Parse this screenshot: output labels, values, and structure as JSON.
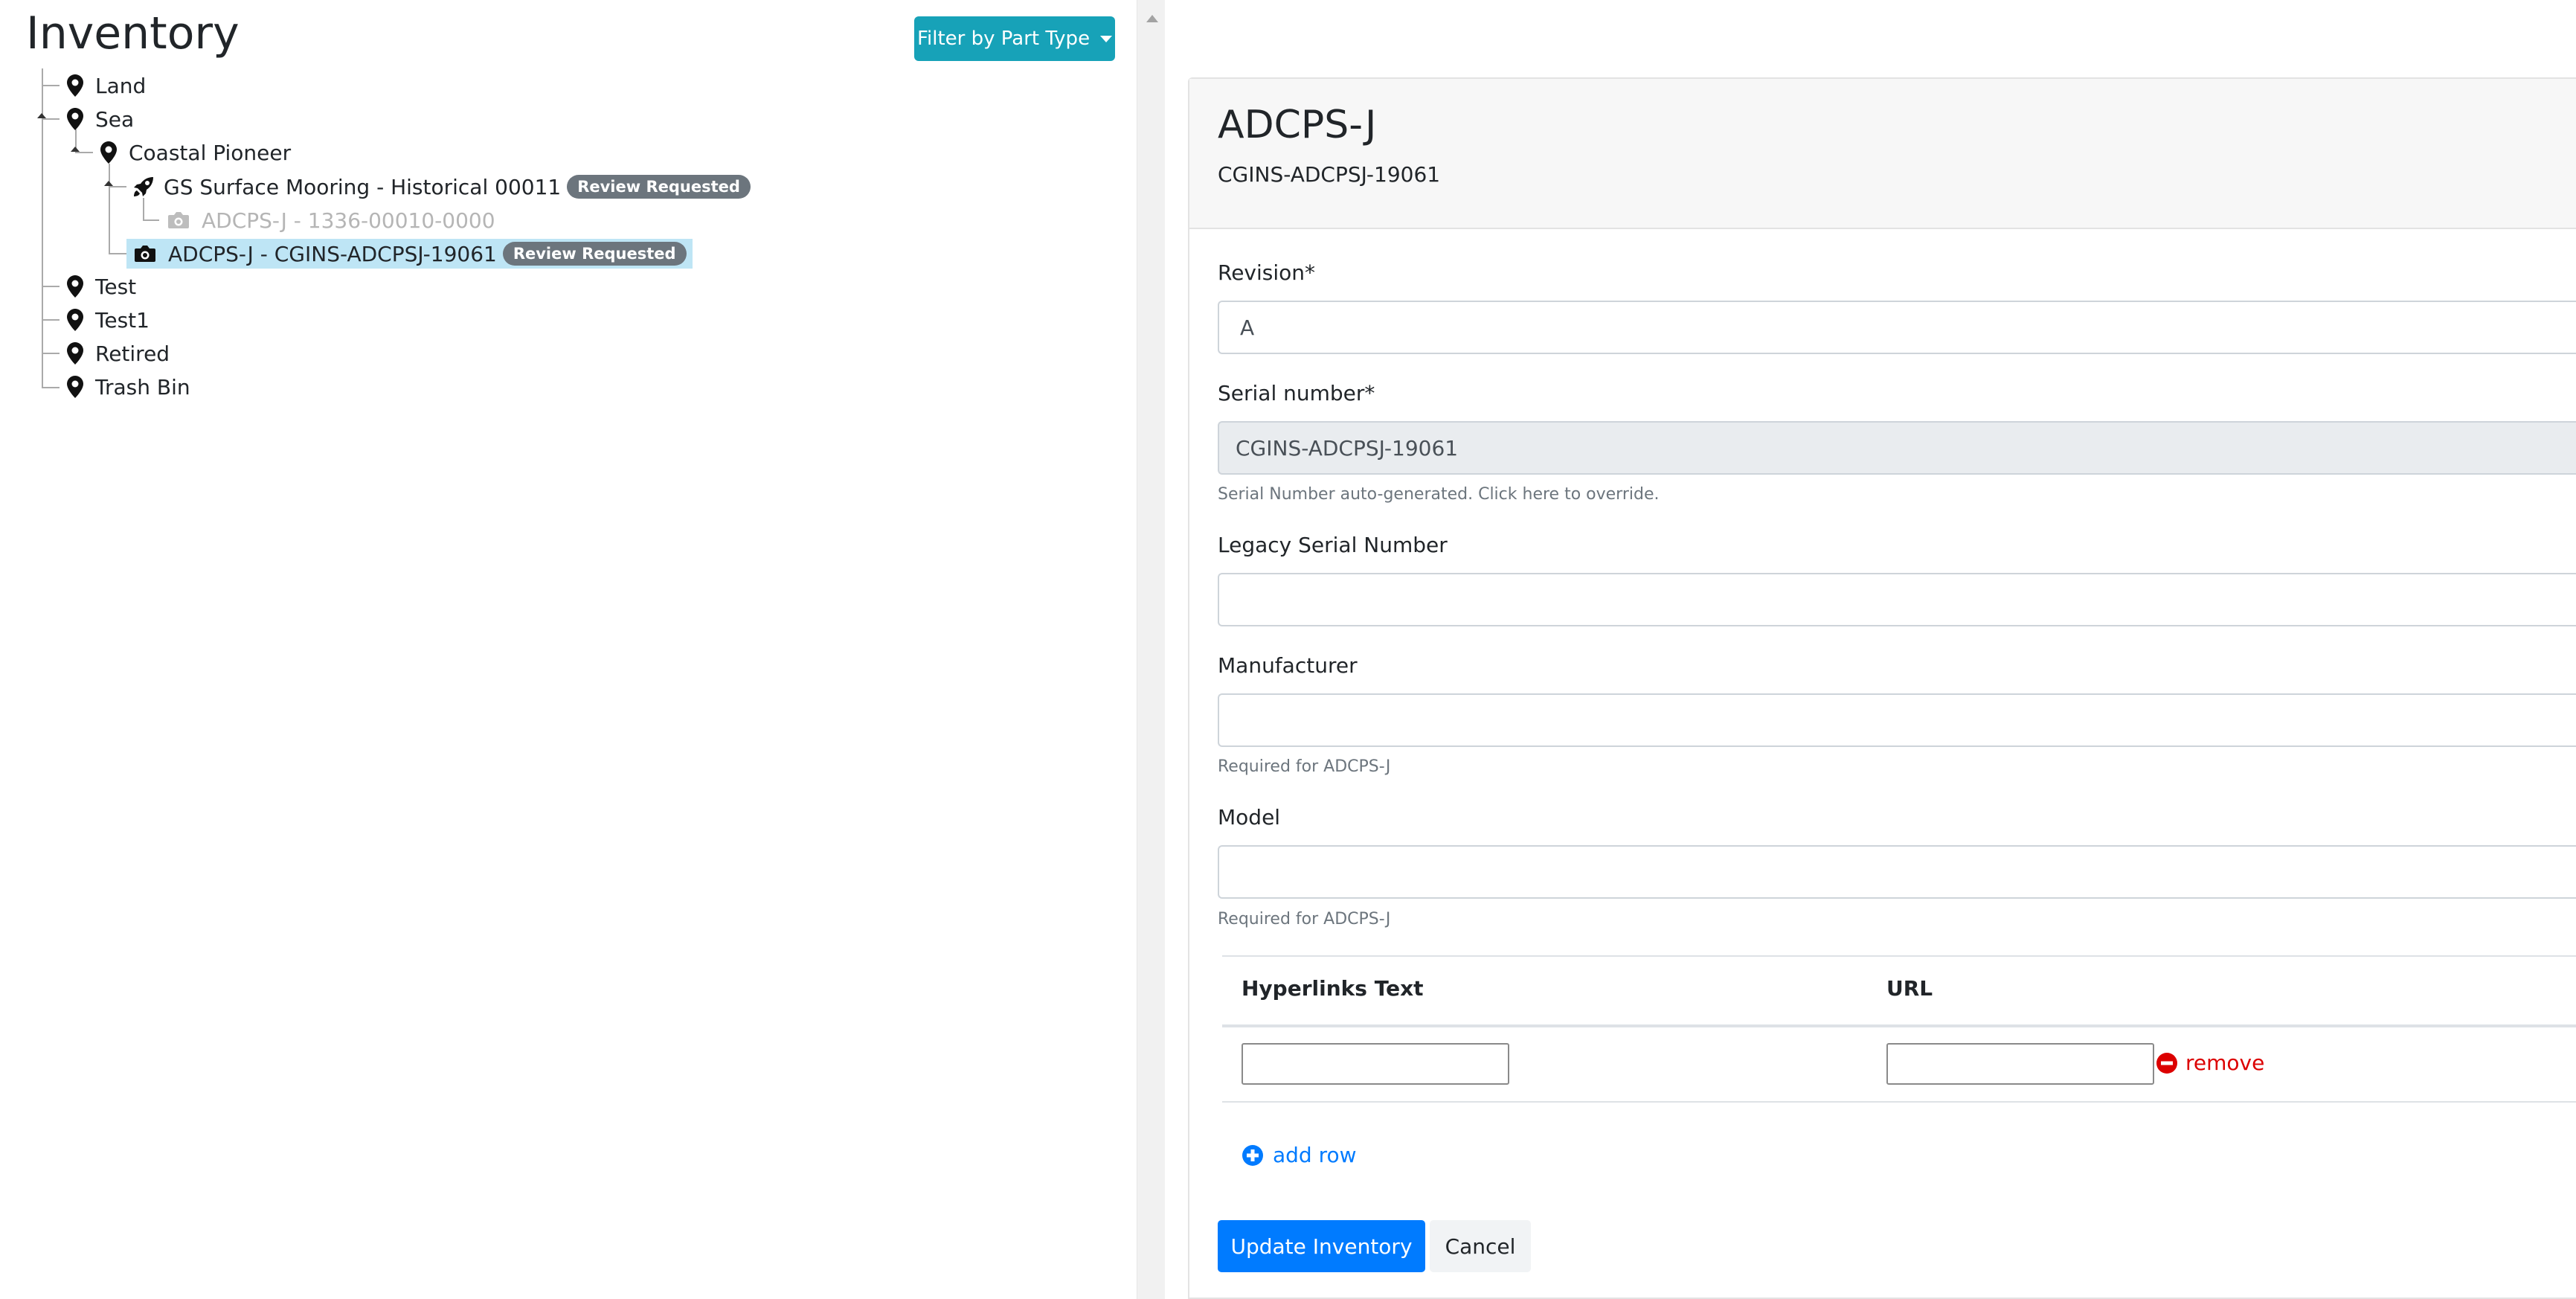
{
  "page": {
    "title": "Inventory",
    "filter_button": "Filter by Part Type"
  },
  "tree": {
    "land": "Land",
    "sea": "Sea",
    "coastal_pioneer": "Coastal Pioneer",
    "mooring": "GS Surface Mooring - Historical 00011",
    "mooring_badge": "Review Requested",
    "child_part": "ADCPS-J - 1336-00010-0000",
    "selected_part": "ADCPS-J - CGINS-ADCPSJ-19061",
    "selected_badge": "Review Requested",
    "test": "Test",
    "test1": "Test1",
    "retired": "Retired",
    "trash": "Trash Bin"
  },
  "detail": {
    "title": "ADCPS-J",
    "subtitle": "CGINS-ADCPSJ-19061"
  },
  "form": {
    "revision_label": "Revision*",
    "revision_value": "A",
    "serial_label": "Serial number*",
    "serial_value": "CGINS-ADCPSJ-19061",
    "serial_help": "Serial Number auto-generated. Click here to override.",
    "legacy_label": "Legacy Serial Number",
    "legacy_value": "",
    "manufacturer_label": "Manufacturer",
    "manufacturer_value": "",
    "manufacturer_help": "Required for ADCPS-J",
    "model_label": "Model",
    "model_value": "",
    "model_help": "Required for ADCPS-J"
  },
  "hyperlinks": {
    "col_text": "Hyperlinks Text",
    "col_url": "URL",
    "rows": [
      {
        "text": "",
        "url": ""
      }
    ],
    "remove_label": "remove",
    "add_row_label": "add row"
  },
  "actions": {
    "update_label": "Update Inventory",
    "cancel_label": "Cancel"
  },
  "colors": {
    "accent_info": "#17a2b8",
    "primary": "#007bff",
    "danger": "#dc0000",
    "badge": "#6c757d",
    "selected_row": "#bee5f5"
  },
  "icons": {
    "location": "map-marker-icon",
    "mooring": "rocket-icon",
    "part": "camera-icon",
    "remove": "minus-circle-icon",
    "add": "plus-circle-icon"
  }
}
